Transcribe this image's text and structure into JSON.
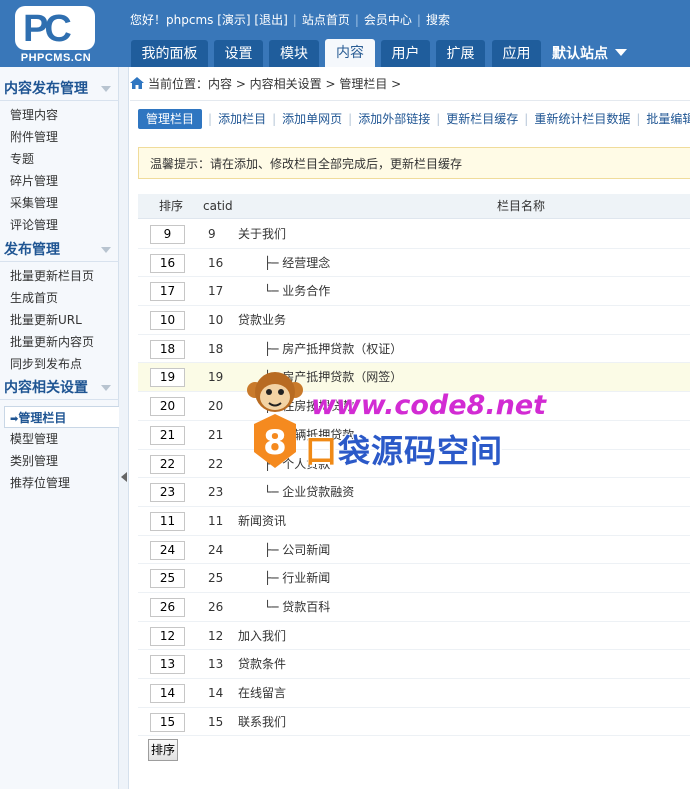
{
  "logo": {
    "mark": "PC",
    "text": "PHPCMS.CN"
  },
  "toplinks": {
    "greeting": "您好！phpcms [演示]",
    "logout": "[退出]",
    "site_home": "站点首页",
    "member_center": "会员中心",
    "search": "搜索"
  },
  "mainnav": {
    "tabs": [
      {
        "label": "我的面板"
      },
      {
        "label": "设置"
      },
      {
        "label": "模块"
      },
      {
        "label": "内容",
        "active": true
      },
      {
        "label": "用户"
      },
      {
        "label": "扩展"
      },
      {
        "label": "应用"
      }
    ],
    "site_select": "默认站点"
  },
  "sidebar": {
    "groups": [
      {
        "title": "内容发布管理",
        "items": [
          "管理内容",
          "附件管理",
          "专题",
          "碎片管理",
          "采集管理",
          "评论管理"
        ]
      },
      {
        "title": "发布管理",
        "items": [
          "批量更新栏目页",
          "生成首页",
          "批量更新URL",
          "批量更新内容页",
          "同步到发布点"
        ]
      },
      {
        "title": "内容相关设置",
        "items": [
          "管理栏目",
          "模型管理",
          "类别管理",
          "推荐位管理"
        ],
        "active": "管理栏目"
      }
    ]
  },
  "breadcrumb": {
    "text": "当前位置：内容 > 内容相关设置 > 管理栏目 >"
  },
  "subnav": {
    "items": [
      "管理栏目",
      "添加栏目",
      "添加单网页",
      "添加外部链接",
      "更新栏目缓存",
      "重新统计栏目数据",
      "批量编辑"
    ],
    "active": "管理栏目"
  },
  "tip": "温馨提示：请在添加、修改栏目全部完成后，更新栏目缓存",
  "table": {
    "headers": {
      "order": "排序",
      "catid": "catid",
      "name": "栏目名称"
    },
    "rows": [
      {
        "order": "9",
        "catid": "9",
        "name": "关于我们",
        "child": false
      },
      {
        "order": "16",
        "catid": "16",
        "name": "├─ 经营理念",
        "child": true
      },
      {
        "order": "17",
        "catid": "17",
        "name": "└─ 业务合作",
        "child": true
      },
      {
        "order": "10",
        "catid": "10",
        "name": "贷款业务",
        "child": false
      },
      {
        "order": "18",
        "catid": "18",
        "name": "├─ 房产抵押贷款（权证）",
        "child": true
      },
      {
        "order": "19",
        "catid": "19",
        "name": "├─ 房产抵押贷款（网签）",
        "child": true,
        "highlight": true
      },
      {
        "order": "20",
        "catid": "20",
        "name": "├─ 住房按揭贷款",
        "child": true
      },
      {
        "order": "21",
        "catid": "21",
        "name": "├─ 车辆抵押贷款",
        "child": true
      },
      {
        "order": "22",
        "catid": "22",
        "name": "├─ 个人贷款",
        "child": true
      },
      {
        "order": "23",
        "catid": "23",
        "name": "└─ 企业贷款融资",
        "child": true
      },
      {
        "order": "11",
        "catid": "11",
        "name": "新闻资讯",
        "child": false
      },
      {
        "order": "24",
        "catid": "24",
        "name": "├─ 公司新闻",
        "child": true
      },
      {
        "order": "25",
        "catid": "25",
        "name": "├─ 行业新闻",
        "child": true
      },
      {
        "order": "26",
        "catid": "26",
        "name": "└─ 贷款百科",
        "child": true
      },
      {
        "order": "12",
        "catid": "12",
        "name": "加入我们",
        "child": false
      },
      {
        "order": "13",
        "catid": "13",
        "name": "贷款条件",
        "child": false
      },
      {
        "order": "14",
        "catid": "14",
        "name": "在线留言",
        "child": false
      },
      {
        "order": "15",
        "catid": "15",
        "name": "联系我们",
        "child": false
      }
    ],
    "sort_button": "排序"
  },
  "watermark": {
    "url": "www.code8.net",
    "badge": "8",
    "text_first": "口",
    "text_rest": "袋源码空间"
  },
  "colors": {
    "header": "#3977b9",
    "nav_tab": "#1f5d9c",
    "accent": "#2f76c1",
    "sidebar_title": "#1f5593",
    "tip_bg": "#fffbe6"
  }
}
